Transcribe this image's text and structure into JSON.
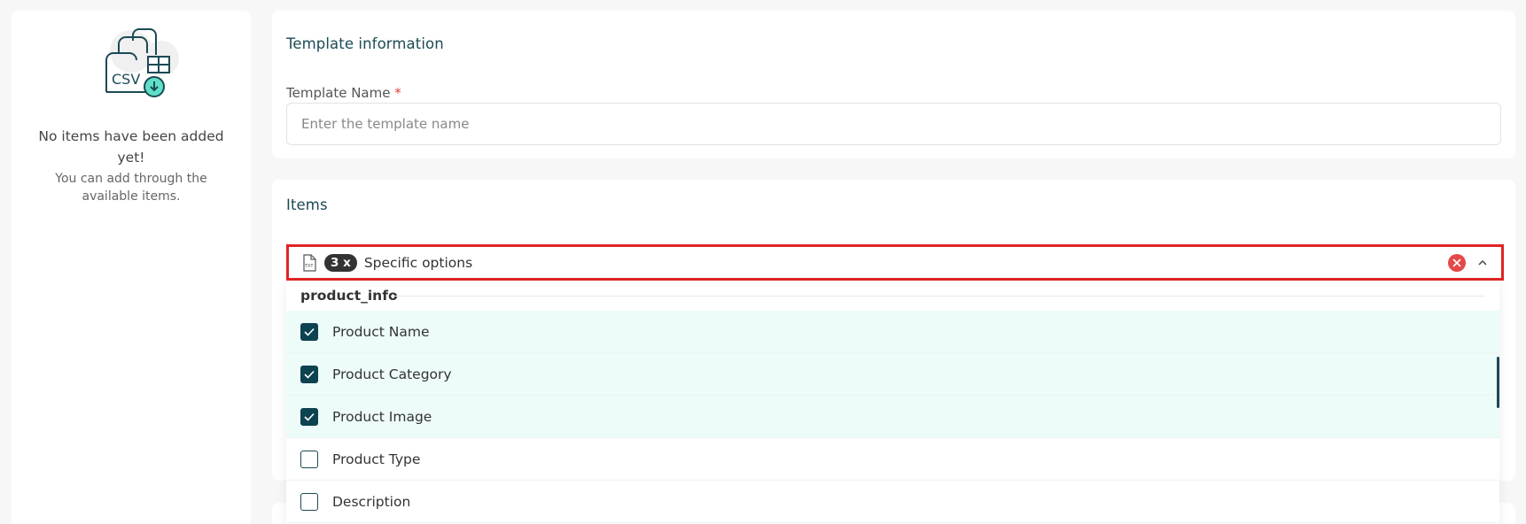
{
  "empty_state": {
    "title": "No items have been added yet!",
    "subtitle": "You can add through the available items.",
    "illustration_text": "CSV"
  },
  "template_info": {
    "title": "Template information",
    "name_label": "Template Name",
    "required_mark": "*",
    "name_value": "",
    "name_placeholder": "Enter the template name"
  },
  "items": {
    "title": "Items",
    "selector": {
      "file_icon": "txt-file-icon",
      "count": "3 x",
      "label": "Specific options"
    },
    "group": "product_info",
    "options": [
      {
        "label": "Product Name",
        "checked": true
      },
      {
        "label": "Product Category",
        "checked": true
      },
      {
        "label": "Product Image",
        "checked": true
      },
      {
        "label": "Product Type",
        "checked": false
      },
      {
        "label": "Description",
        "checked": false
      }
    ]
  },
  "colors": {
    "accent": "#1b4a55",
    "checked_bg": "#edfcf9",
    "highlight_border": "#e02424",
    "clear_button": "#e54848"
  }
}
